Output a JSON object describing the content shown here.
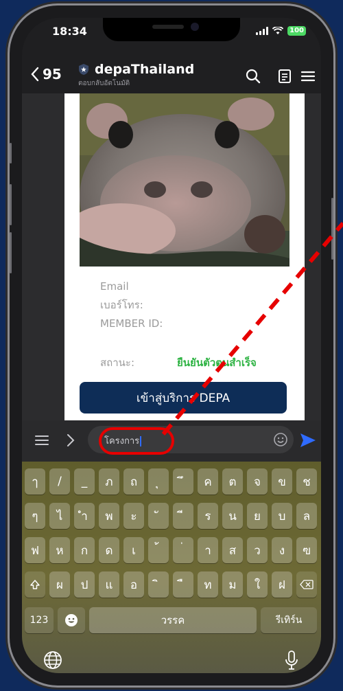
{
  "status_bar": {
    "time": "18:34",
    "battery": "100"
  },
  "header": {
    "back_count": "95",
    "channel_name": "depaThailand",
    "channel_subtitle": "ตอบกลับอัตโนมัติ"
  },
  "card": {
    "fields": [
      "Email",
      "เบอร์โทร:",
      "MEMBER ID:"
    ],
    "status_label": "สถานะ:",
    "status_value": "ยืนยันตัวตนสำเร็จ",
    "cta_label": "เข้าสู่บริการ DEPA"
  },
  "input": {
    "value": "โครงการ"
  },
  "keyboard": {
    "row1": [
      "ๅ",
      "/",
      "_",
      "ภ",
      "ถ",
      "ุ",
      "ึ",
      "ค",
      "ต",
      "จ",
      "ข",
      "ช"
    ],
    "row2": [
      "ๆ",
      "ไ",
      "ำ",
      "พ",
      "ะ",
      "ั",
      "ี",
      "ร",
      "น",
      "ย",
      "บ",
      "ล"
    ],
    "row3": [
      "ฟ",
      "ห",
      "ก",
      "ด",
      "เ",
      "้",
      "่",
      "า",
      "ส",
      "ว",
      "ง",
      "ฃ"
    ],
    "row4": [
      "ผ",
      "ป",
      "แ",
      "อ",
      "ิ",
      "ื",
      "ท",
      "ม",
      "ใ",
      "ฝ"
    ],
    "numbers_label": "123",
    "space_label": "วรรค",
    "return_label": "รีเทิร์น"
  },
  "colors": {
    "accent_blue": "#2f6bff",
    "highlight_red": "#e60000",
    "verified_green": "#2fb344",
    "cta_navy": "#0e2d57"
  }
}
